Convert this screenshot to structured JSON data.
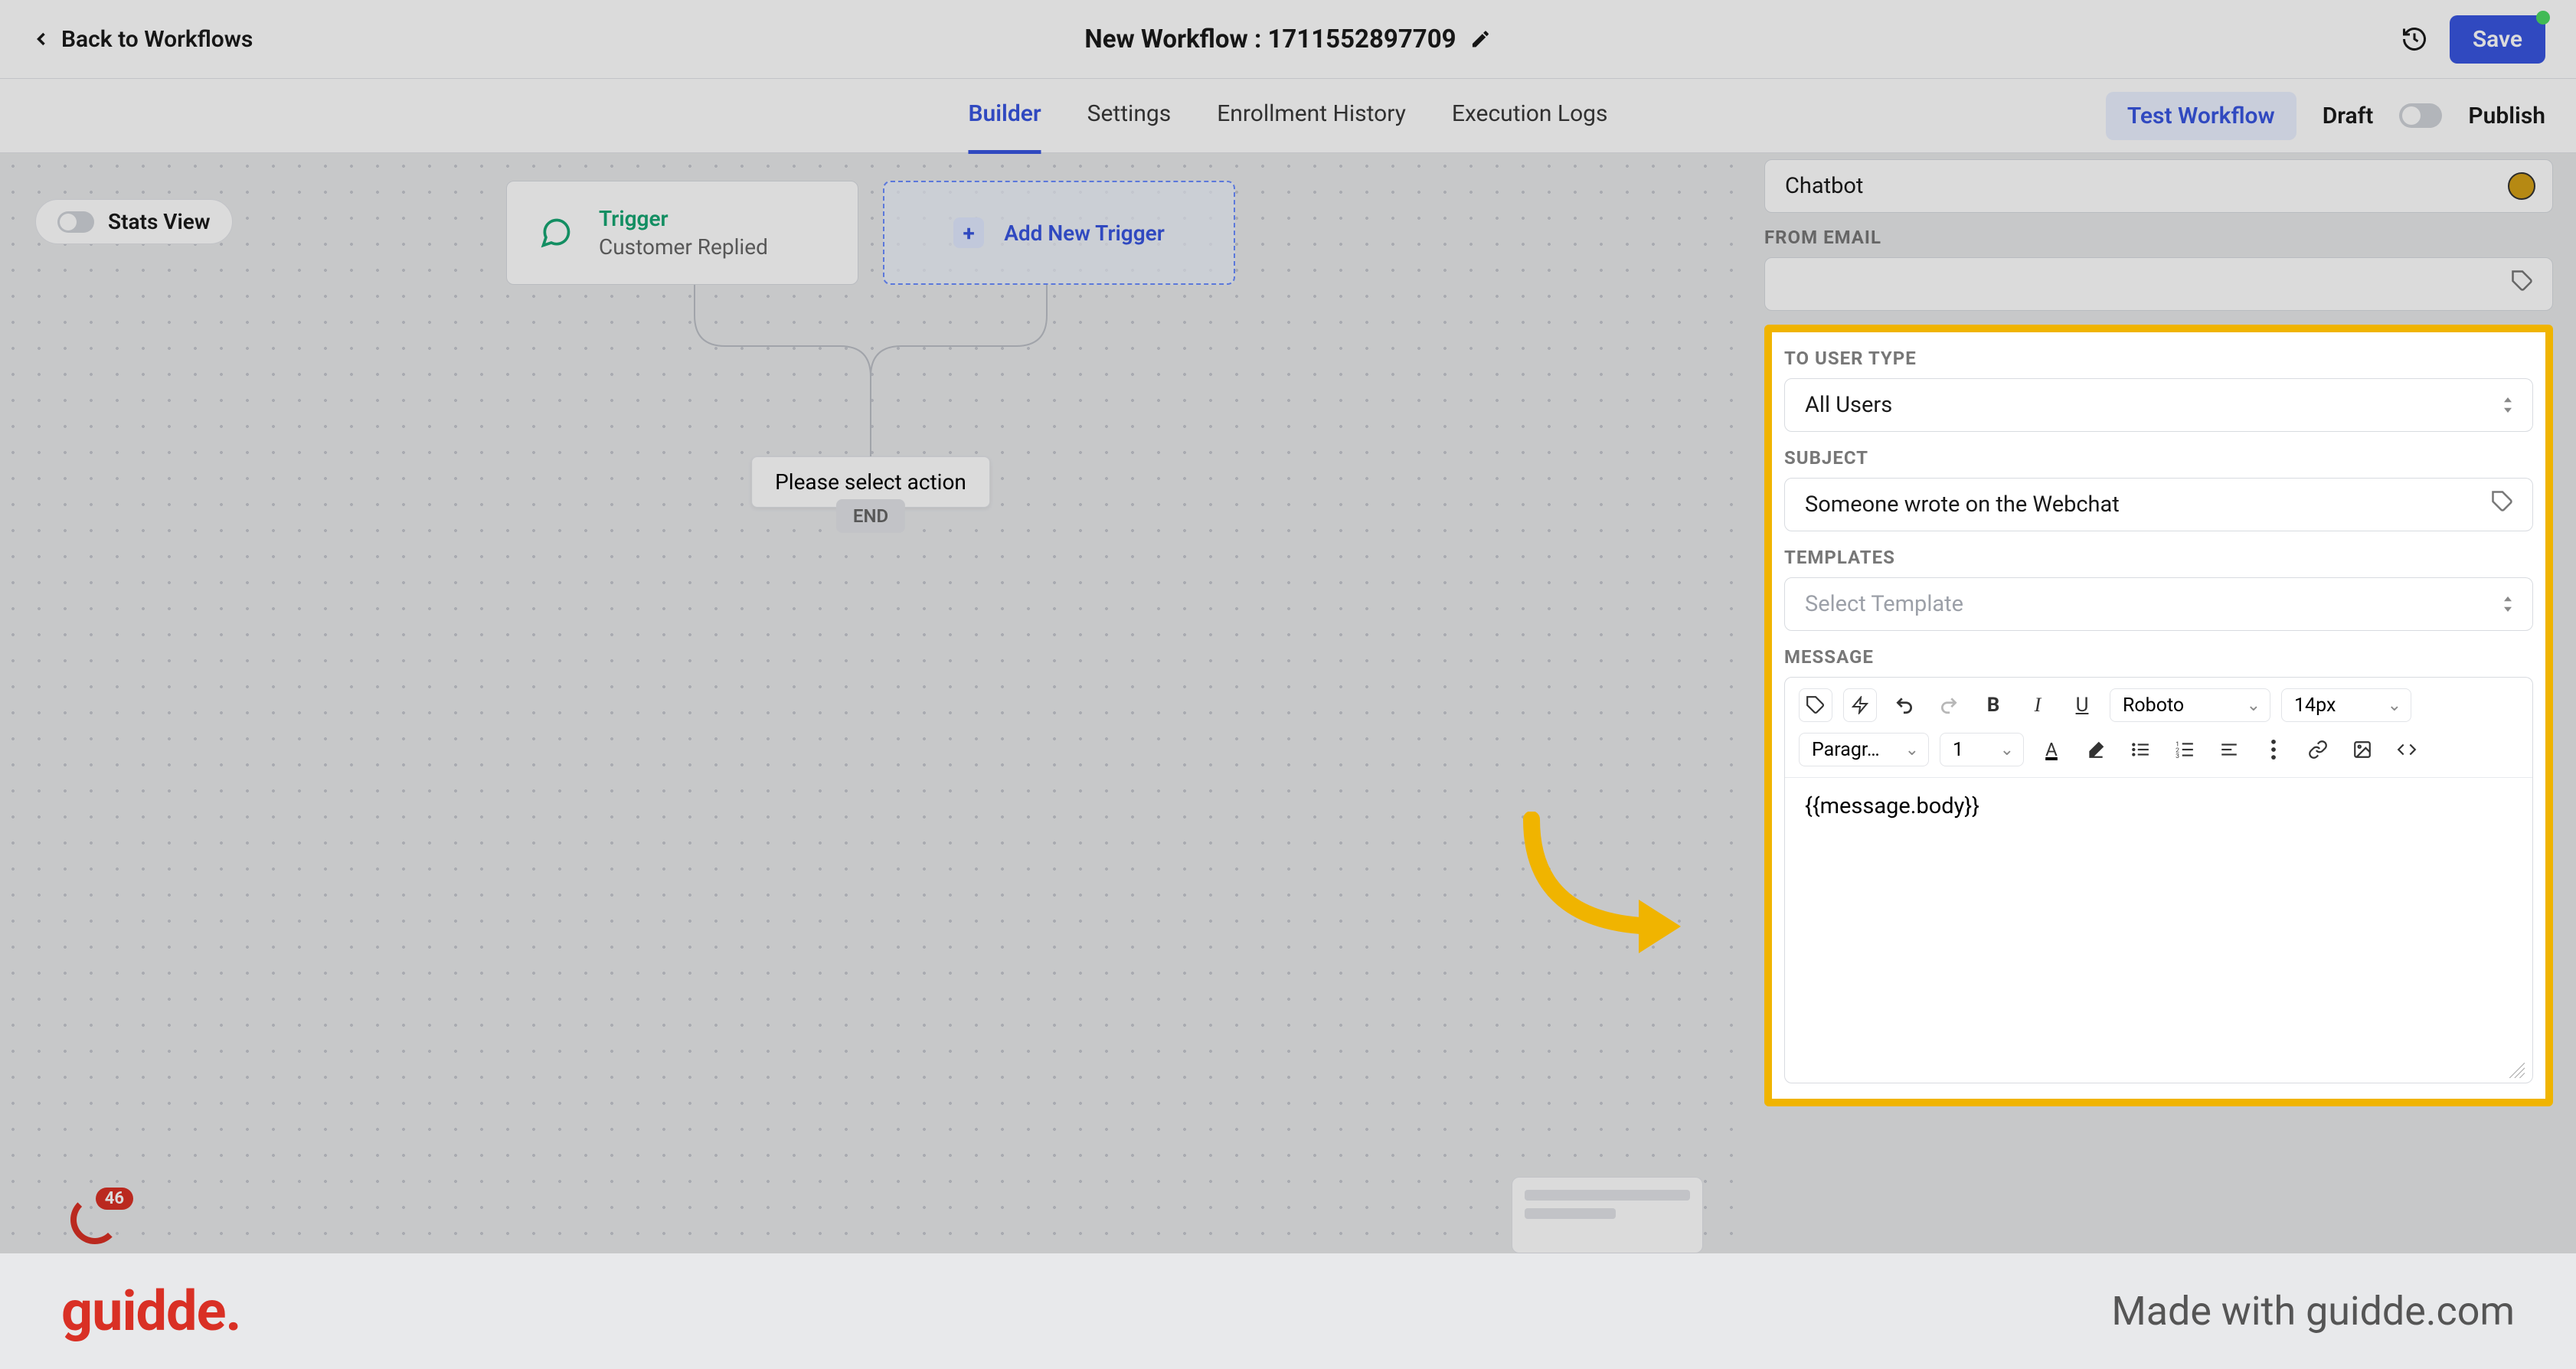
{
  "header": {
    "back_label": "Back to Workflows",
    "title": "New Workflow : 1711552897709",
    "save_label": "Save"
  },
  "tabs": {
    "builder": "Builder",
    "settings": "Settings",
    "enrollment": "Enrollment History",
    "execution": "Execution Logs",
    "test_label": "Test Workflow",
    "draft": "Draft",
    "publish": "Publish"
  },
  "canvas": {
    "stats_label": "Stats View",
    "trigger_title": "Trigger",
    "trigger_sub": "Customer Replied",
    "add_trigger": "Add New Trigger",
    "select_action": "Please select action",
    "end_label": "END",
    "badge_count": "46"
  },
  "panel": {
    "chatbot_value": "Chatbot",
    "from_email_label": "FROM EMAIL",
    "to_user_type_label": "TO USER TYPE",
    "to_user_type_value": "All Users",
    "subject_label": "SUBJECT",
    "subject_value": "Someone wrote on the Webchat",
    "templates_label": "TEMPLATES",
    "templates_placeholder": "Select Template",
    "message_label": "MESSAGE",
    "editor": {
      "font": "Roboto",
      "size": "14px",
      "style": "Paragr…",
      "line": "1",
      "content": "{{message.body}}"
    }
  },
  "footer": {
    "logo": "guidde.",
    "tagline": "Made with guidde.com"
  }
}
